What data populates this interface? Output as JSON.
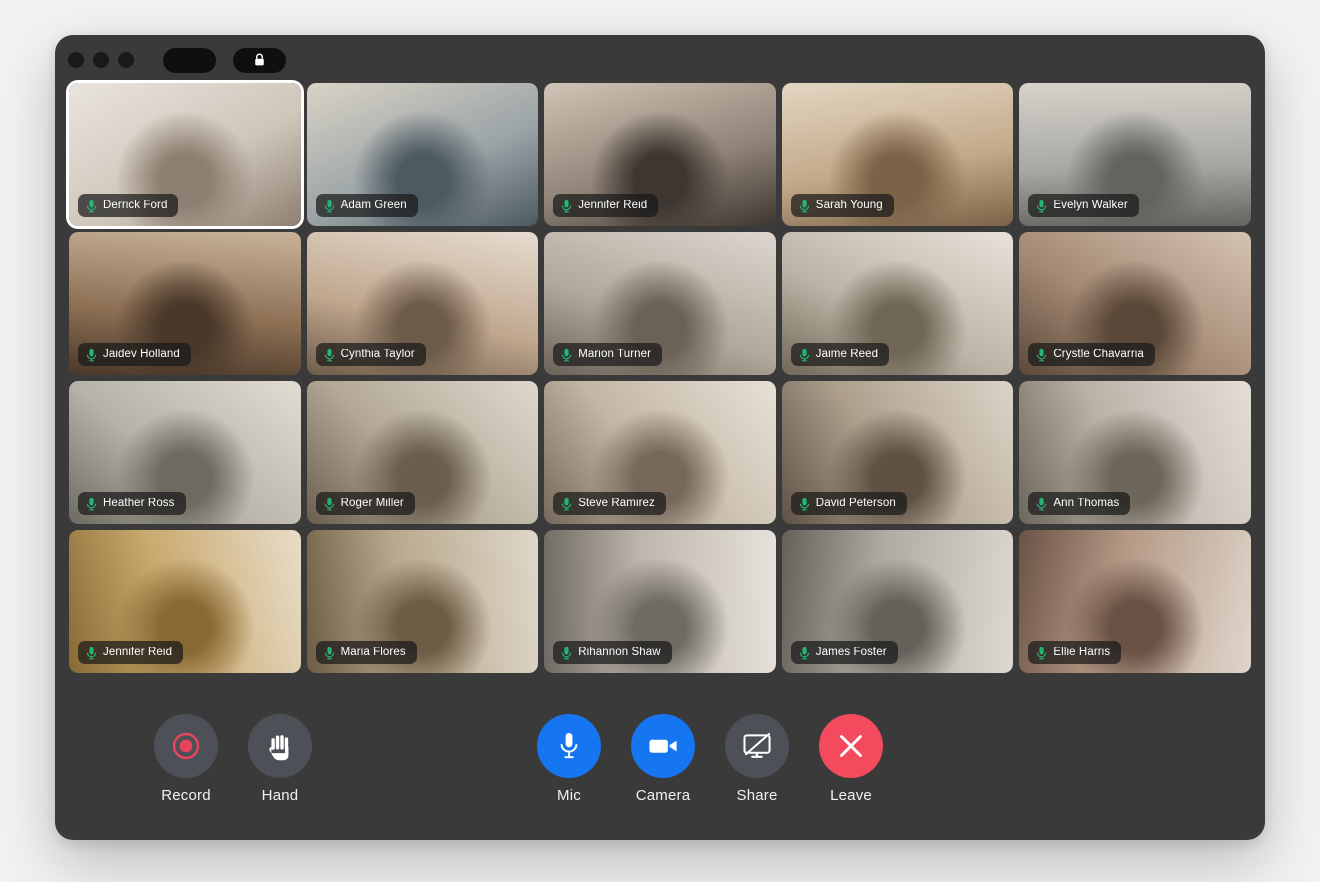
{
  "window": {
    "titlebar": {
      "dots": [
        "window-dot-1",
        "window-dot-2",
        "window-dot-3"
      ],
      "pill_label": "",
      "lock_icon": "lock-icon"
    }
  },
  "grid": {
    "columns": 5,
    "rows": 4,
    "mic_icon": "microphone-icon",
    "mic_color": "#22b573",
    "active_border_color": "#ffffff",
    "participants": [
      {
        "name": "Derrick Ford",
        "mic": "on",
        "active": true,
        "bg": "derrick-ford-video"
      },
      {
        "name": "Adam Green",
        "mic": "on",
        "active": false,
        "bg": "adam-green-video"
      },
      {
        "name": "Jennifer Reid",
        "mic": "on",
        "active": false,
        "bg": "jennifer-reid-video"
      },
      {
        "name": "Sarah Young",
        "mic": "on",
        "active": false,
        "bg": "sarah-young-video"
      },
      {
        "name": "Evelyn Walker",
        "mic": "on",
        "active": false,
        "bg": "evelyn-walker-video"
      },
      {
        "name": "Jaidev Holland",
        "mic": "on",
        "active": false,
        "bg": "jaidev-holland-video"
      },
      {
        "name": "Cynthia Taylor",
        "mic": "on",
        "active": false,
        "bg": "cynthia-taylor-video"
      },
      {
        "name": "Marion Turner",
        "mic": "on",
        "active": false,
        "bg": "marion-turner-video"
      },
      {
        "name": "Jaime Reed",
        "mic": "on",
        "active": false,
        "bg": "jaime-reed-video"
      },
      {
        "name": "Crystle Chavarria",
        "mic": "on",
        "active": false,
        "bg": "crystle-chavarria-video"
      },
      {
        "name": "Heather Ross",
        "mic": "on",
        "active": false,
        "bg": "heather-ross-video"
      },
      {
        "name": "Roger Miller",
        "mic": "on",
        "active": false,
        "bg": "roger-miller-video"
      },
      {
        "name": "Steve Ramirez",
        "mic": "on",
        "active": false,
        "bg": "steve-ramirez-video"
      },
      {
        "name": "David Peterson",
        "mic": "on",
        "active": false,
        "bg": "david-peterson-video"
      },
      {
        "name": "Ann Thomas",
        "mic": "on",
        "active": false,
        "bg": "ann-thomas-video"
      },
      {
        "name": "Jennifer Reid",
        "mic": "on",
        "active": false,
        "bg": "jennifer-reid-2-video"
      },
      {
        "name": "Maria Flores",
        "mic": "on",
        "active": false,
        "bg": "maria-flores-video"
      },
      {
        "name": "Rihannon Shaw",
        "mic": "on",
        "active": false,
        "bg": "rihannon-shaw-video"
      },
      {
        "name": "James Foster",
        "mic": "on",
        "active": false,
        "bg": "james-foster-video"
      },
      {
        "name": "Ellie Harris",
        "mic": "on",
        "active": false,
        "bg": "ellie-harris-video"
      }
    ]
  },
  "toolbar": {
    "left_controls": [
      {
        "label": "Record",
        "icon": "record-icon",
        "style": "gray"
      },
      {
        "label": "Hand",
        "icon": "raise-hand-icon",
        "style": "gray"
      }
    ],
    "center_controls": [
      {
        "label": "Mic",
        "icon": "microphone-icon",
        "style": "blue"
      },
      {
        "label": "Camera",
        "icon": "video-camera-icon",
        "style": "blue"
      },
      {
        "label": "Share",
        "icon": "screen-share-off-icon",
        "style": "gray"
      },
      {
        "label": "Leave",
        "icon": "close-x-icon",
        "style": "red"
      }
    ],
    "colors": {
      "gray": "#4d5157",
      "blue": "#1675f0",
      "red": "#f44a5e",
      "record_red": "#e8445c"
    }
  }
}
